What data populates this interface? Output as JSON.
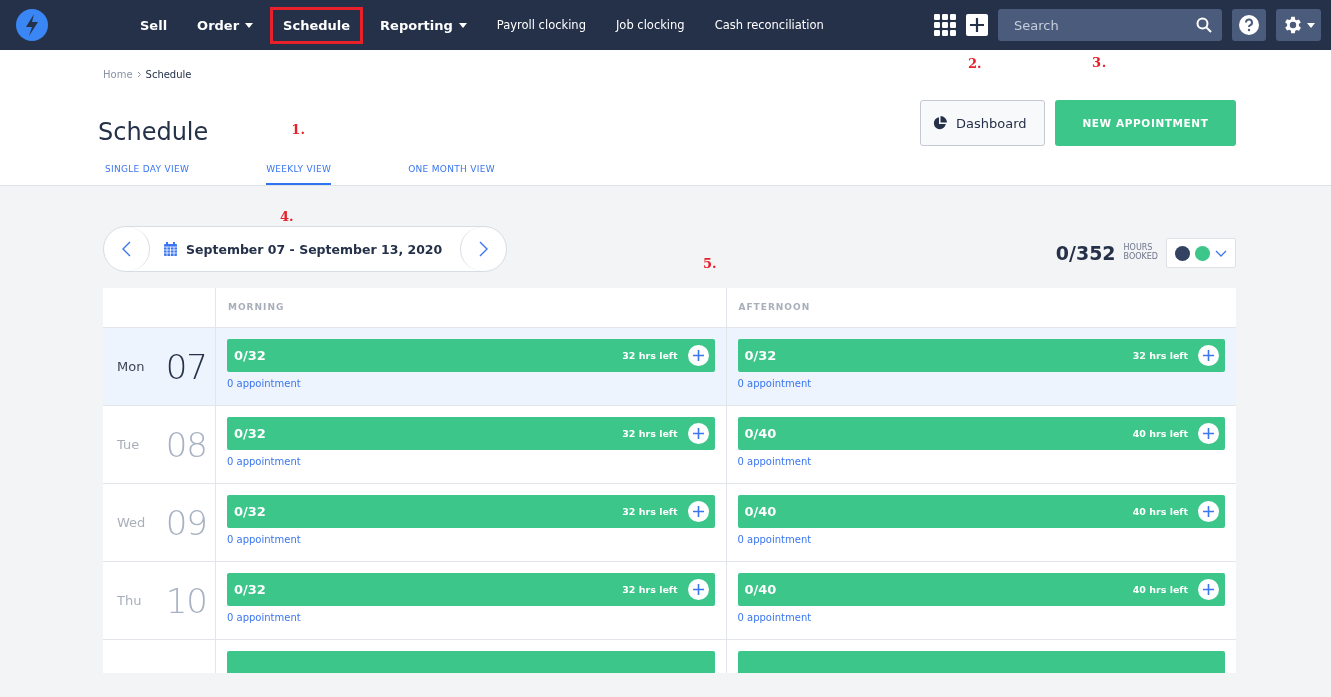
{
  "nav": {
    "items": [
      {
        "label": "Sell",
        "kind": "bold",
        "highlighted": false
      },
      {
        "label": "Order",
        "kind": "dropdown",
        "highlighted": false
      },
      {
        "label": "Schedule",
        "kind": "bold",
        "highlighted": true
      },
      {
        "label": "Reporting",
        "kind": "dropdown",
        "highlighted": false
      },
      {
        "label": "Payroll clocking",
        "kind": "plain",
        "highlighted": false
      },
      {
        "label": "Job clocking",
        "kind": "plain",
        "highlighted": false
      },
      {
        "label": "Cash reconciliation",
        "kind": "plain",
        "highlighted": false
      }
    ],
    "search": {
      "placeholder": "Search"
    }
  },
  "breadcrumb": [
    {
      "label": "Home",
      "current": false
    },
    {
      "label": "Schedule",
      "current": true
    }
  ],
  "title": "Schedule",
  "buttons": [
    {
      "label": "Dashboard",
      "kind": "outline",
      "annotation": "2."
    },
    {
      "label": "NEW APPOINTMENT",
      "kind": "primary",
      "annotation": "3."
    }
  ],
  "tabs": [
    {
      "label": "SINGLE DAY VIEW",
      "selected": false
    },
    {
      "label": "WEEKLY VIEW",
      "selected": true,
      "annotation": "1."
    },
    {
      "label": "ONE MONTH VIEW",
      "selected": false
    }
  ],
  "date_range": {
    "label": "September 07 - September 13, 2020",
    "annotation": "4."
  },
  "hours": {
    "value": "0/352",
    "label_top": "HOURS",
    "label_bottom": "BOOKED"
  },
  "legend": [
    {
      "color": "#334260"
    },
    {
      "color": "#3cc68a"
    }
  ],
  "table": {
    "annotation": "5.",
    "columns": [
      "MORNING",
      "AFTERNOON"
    ],
    "rows": [
      {
        "kind": "day",
        "day": "Mon",
        "date": "07",
        "today": true,
        "slots": [
          {
            "booked": "0/32",
            "left": "32 hrs left",
            "appointments": "0 appointment"
          },
          {
            "booked": "0/32",
            "left": "32 hrs left",
            "appointments": "0 appointment"
          }
        ]
      },
      {
        "kind": "day",
        "day": "Tue",
        "date": "08",
        "today": false,
        "slots": [
          {
            "booked": "0/32",
            "left": "32 hrs left",
            "appointments": "0 appointment"
          },
          {
            "booked": "0/40",
            "left": "40 hrs left",
            "appointments": "0 appointment"
          }
        ]
      },
      {
        "kind": "day",
        "day": "Wed",
        "date": "09",
        "today": false,
        "slots": [
          {
            "booked": "0/32",
            "left": "32 hrs left",
            "appointments": "0 appointment"
          },
          {
            "booked": "0/40",
            "left": "40 hrs left",
            "appointments": "0 appointment"
          }
        ]
      },
      {
        "kind": "day",
        "day": "Thu",
        "date": "10",
        "today": false,
        "slots": [
          {
            "booked": "0/32",
            "left": "32 hrs left",
            "appointments": "0 appointment"
          },
          {
            "booked": "0/40",
            "left": "40 hrs left",
            "appointments": "0 appointment"
          }
        ]
      },
      {
        "kind": "cut"
      }
    ]
  }
}
